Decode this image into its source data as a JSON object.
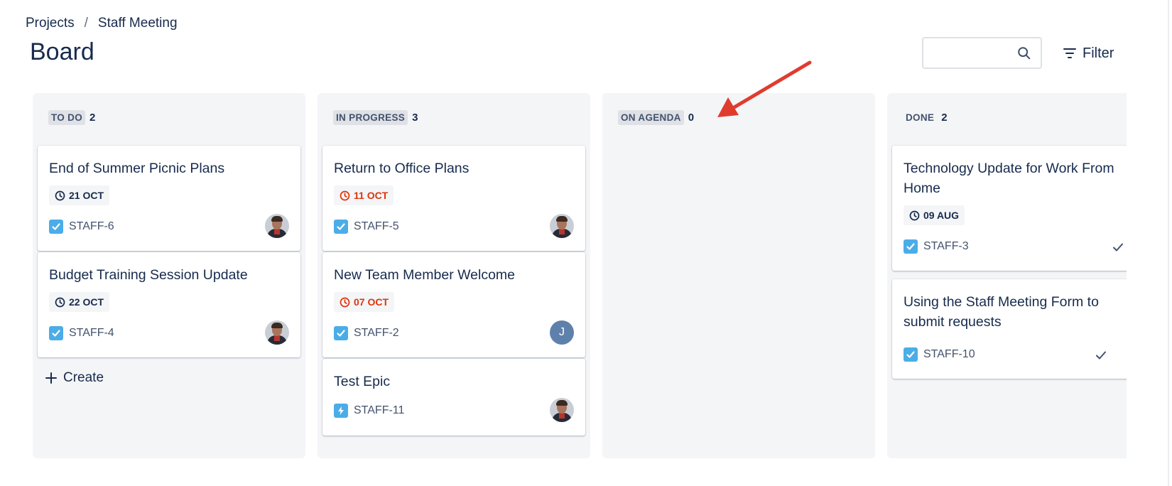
{
  "breadcrumb": {
    "projects": "Projects",
    "separator": "/",
    "current": "Staff Meeting"
  },
  "page_title": "Board",
  "search": {
    "value": "",
    "placeholder": ""
  },
  "filter_label": "Filter",
  "colors": {
    "overdue": "#de350b",
    "column_bg": "#f4f5f7",
    "annotation_arrow": "#e03c2e",
    "task_icon": "#4bade8"
  },
  "columns": [
    {
      "name": "TO DO",
      "count": "2",
      "cards": [
        {
          "title": "End of Summer Picnic Plans",
          "date": "21 OCT",
          "overdue": false,
          "key": "STAFF-6",
          "type_icon": "checkbox-icon",
          "avatar": "photo"
        },
        {
          "title": "Budget Training Session Update",
          "date": "22 OCT",
          "overdue": false,
          "key": "STAFF-4",
          "type_icon": "checkbox-icon",
          "avatar": "photo"
        }
      ],
      "create_label": "Create"
    },
    {
      "name": "IN PROGRESS",
      "count": "3",
      "cards": [
        {
          "title": "Return to Office Plans",
          "date": "11 OCT",
          "overdue": true,
          "key": "STAFF-5",
          "type_icon": "checkbox-icon",
          "avatar": "photo"
        },
        {
          "title": "New Team Member Welcome",
          "date": "07 OCT",
          "overdue": true,
          "key": "STAFF-2",
          "type_icon": "checkbox-icon",
          "avatar": "J"
        },
        {
          "title": "Test Epic",
          "key": "STAFF-11",
          "type_icon": "lightning-icon",
          "avatar": "photo"
        }
      ]
    },
    {
      "name": "ON AGENDA",
      "count": "0",
      "cards": []
    },
    {
      "name": "DONE",
      "count": "2",
      "cards": [
        {
          "title": "Technology Update for Work From Home",
          "date": "09 AUG",
          "overdue": false,
          "key": "STAFF-3",
          "type_icon": "checkbox-icon",
          "done": true
        },
        {
          "title": "Using the Staff Meeting Form to submit requests",
          "key": "STAFF-10",
          "type_icon": "checkbox-icon",
          "done": true,
          "avatar": "photo"
        }
      ]
    }
  ]
}
